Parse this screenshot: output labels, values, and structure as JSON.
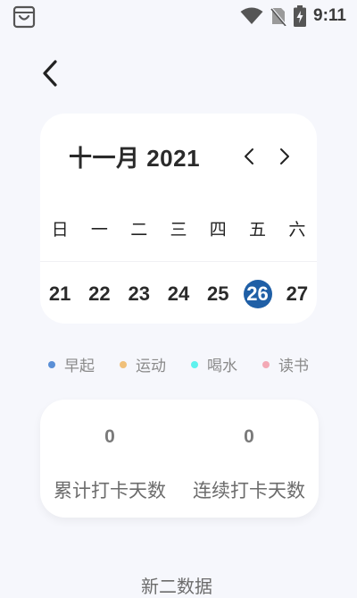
{
  "status_bar": {
    "time": "9:11"
  },
  "calendar": {
    "title": "十一月 2021",
    "weekdays": [
      "日",
      "一",
      "二",
      "三",
      "四",
      "五",
      "六"
    ],
    "days": [
      "21",
      "22",
      "23",
      "24",
      "25",
      "26",
      "27"
    ],
    "selected_day": "26",
    "accent_color": "#1f5fa6"
  },
  "legend": [
    {
      "label": "早起",
      "color": "#5a8fd6"
    },
    {
      "label": "运动",
      "color": "#f0c07a"
    },
    {
      "label": "喝水",
      "color": "#5ef2ee"
    },
    {
      "label": "读书",
      "color": "#f3a9b5"
    }
  ],
  "stats": {
    "total": {
      "value": "0",
      "label": "累计打卡天数"
    },
    "streak": {
      "value": "0",
      "label": "连续打卡天数"
    }
  },
  "bottom_text": "新二数据"
}
